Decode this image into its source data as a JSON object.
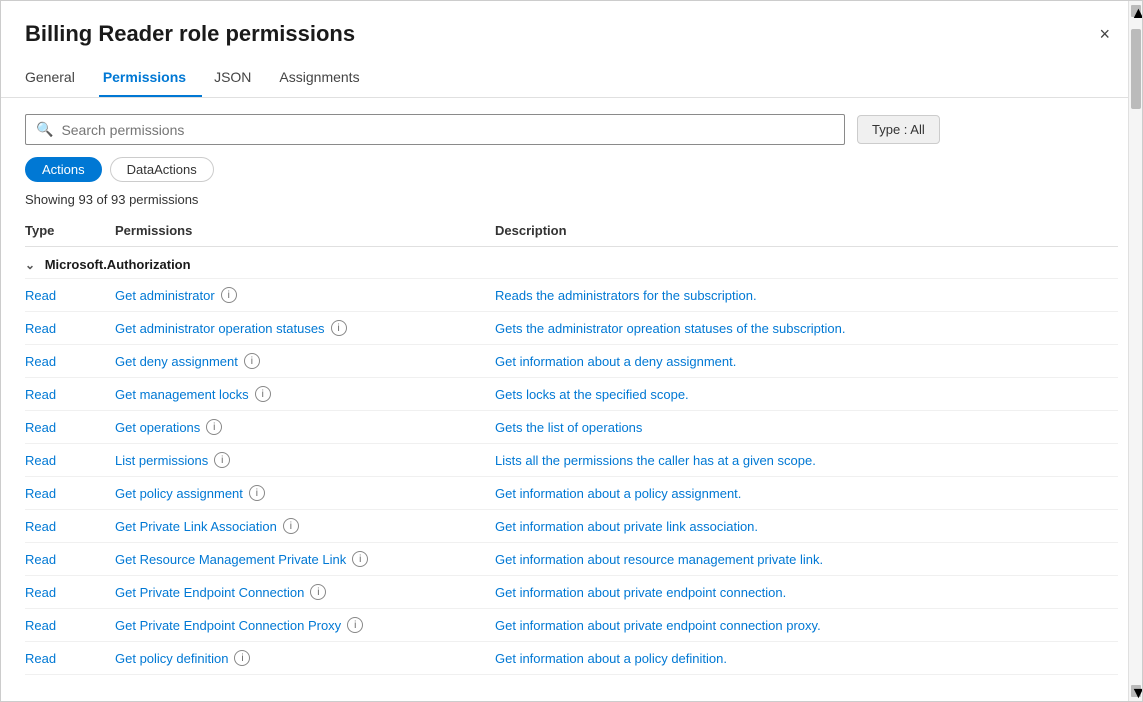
{
  "dialog": {
    "title": "Billing Reader role permissions",
    "close_label": "×"
  },
  "tabs": [
    {
      "label": "General",
      "active": false
    },
    {
      "label": "Permissions",
      "active": true
    },
    {
      "label": "JSON",
      "active": false
    },
    {
      "label": "Assignments",
      "active": false
    }
  ],
  "search": {
    "placeholder": "Search permissions",
    "value": ""
  },
  "type_badge": "Type : All",
  "filters": [
    {
      "label": "Actions",
      "active": true
    },
    {
      "label": "DataActions",
      "active": false
    }
  ],
  "showing_text": "Showing 93 of 93 permissions",
  "table": {
    "headers": [
      "Type",
      "Permissions",
      "Description"
    ],
    "group": "Microsoft.Authorization",
    "rows": [
      {
        "type": "Read",
        "permission": "Get administrator",
        "description": "Reads the administrators for the subscription."
      },
      {
        "type": "Read",
        "permission": "Get administrator operation statuses",
        "description": "Gets the administrator opreation statuses of the subscription."
      },
      {
        "type": "Read",
        "permission": "Get deny assignment",
        "description": "Get information about a deny assignment."
      },
      {
        "type": "Read",
        "permission": "Get management locks",
        "description": "Gets locks at the specified scope."
      },
      {
        "type": "Read",
        "permission": "Get operations",
        "description": "Gets the list of operations"
      },
      {
        "type": "Read",
        "permission": "List permissions",
        "description": "Lists all the permissions the caller has at a given scope."
      },
      {
        "type": "Read",
        "permission": "Get policy assignment",
        "description": "Get information about a policy assignment."
      },
      {
        "type": "Read",
        "permission": "Get Private Link Association",
        "description": "Get information about private link association."
      },
      {
        "type": "Read",
        "permission": "Get Resource Management Private Link",
        "description": "Get information about resource management private link."
      },
      {
        "type": "Read",
        "permission": "Get Private Endpoint Connection",
        "description": "Get information about private endpoint connection."
      },
      {
        "type": "Read",
        "permission": "Get Private Endpoint Connection Proxy",
        "description": "Get information about private endpoint connection proxy."
      },
      {
        "type": "Read",
        "permission": "Get policy definition",
        "description": "Get information about a policy definition."
      }
    ]
  }
}
